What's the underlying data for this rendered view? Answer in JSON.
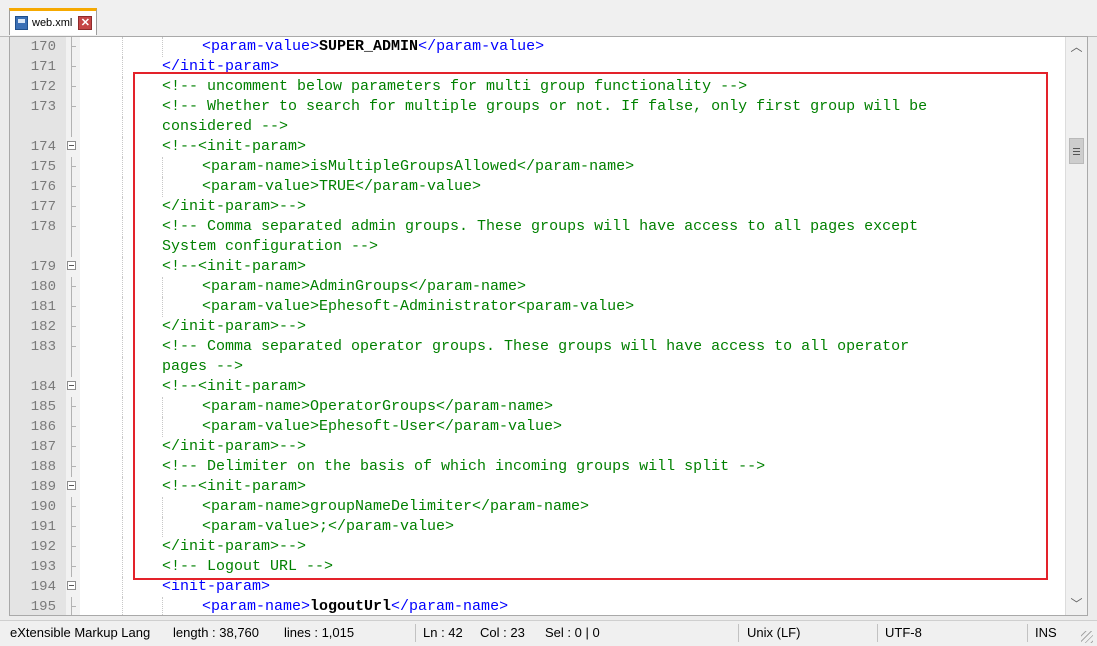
{
  "tab": {
    "filename": "web.xml",
    "close_glyph": "✕"
  },
  "editor": {
    "lines": [
      {
        "n": "170",
        "indent": 2,
        "parts": [
          {
            "c": "tag",
            "t": "<param-value>"
          },
          {
            "c": "txt",
            "t": "SUPER_ADMIN"
          },
          {
            "c": "tag",
            "t": "</param-value>"
          }
        ]
      },
      {
        "n": "171",
        "indent": 1,
        "parts": [
          {
            "c": "tag",
            "t": "</init-param>"
          }
        ]
      },
      {
        "n": "172",
        "indent": 1,
        "parts": [
          {
            "c": "cmt",
            "t": "<!-- uncomment below parameters for multi group functionality -->"
          }
        ]
      },
      {
        "n": "173",
        "indent": 1,
        "parts": [
          {
            "c": "cmt",
            "t": "<!-- Whether to search for multiple groups or not. If false, only first group will be"
          }
        ]
      },
      {
        "n": "",
        "indent": 1,
        "parts": [
          {
            "c": "cmt",
            "t": "considered -->"
          }
        ]
      },
      {
        "n": "174",
        "indent": 1,
        "fold": true,
        "parts": [
          {
            "c": "cmt",
            "t": "<!--<init-param>"
          }
        ]
      },
      {
        "n": "175",
        "indent": 2,
        "parts": [
          {
            "c": "cmt",
            "t": "<param-name>isMultipleGroupsAllowed</param-name>"
          }
        ]
      },
      {
        "n": "176",
        "indent": 2,
        "parts": [
          {
            "c": "cmt",
            "t": "<param-value>TRUE</param-value>"
          }
        ]
      },
      {
        "n": "177",
        "indent": 1,
        "parts": [
          {
            "c": "cmt",
            "t": "</init-param>-->"
          }
        ]
      },
      {
        "n": "178",
        "indent": 1,
        "parts": [
          {
            "c": "cmt",
            "t": "<!-- Comma separated admin groups. These groups will have access to all pages except"
          }
        ]
      },
      {
        "n": "",
        "indent": 1,
        "parts": [
          {
            "c": "cmt",
            "t": "System configuration -->"
          }
        ]
      },
      {
        "n": "179",
        "indent": 1,
        "fold": true,
        "parts": [
          {
            "c": "cmt",
            "t": "<!--<init-param>"
          }
        ]
      },
      {
        "n": "180",
        "indent": 2,
        "parts": [
          {
            "c": "cmt",
            "t": "<param-name>AdminGroups</param-name>"
          }
        ]
      },
      {
        "n": "181",
        "indent": 2,
        "parts": [
          {
            "c": "cmt",
            "t": "<param-value>Ephesoft-Administrator<param-value>"
          }
        ]
      },
      {
        "n": "182",
        "indent": 1,
        "parts": [
          {
            "c": "cmt",
            "t": "</init-param>-->"
          }
        ]
      },
      {
        "n": "183",
        "indent": 1,
        "parts": [
          {
            "c": "cmt",
            "t": "<!-- Comma separated operator groups. These groups will have access to all operator"
          }
        ]
      },
      {
        "n": "",
        "indent": 1,
        "parts": [
          {
            "c": "cmt",
            "t": "pages -->"
          }
        ]
      },
      {
        "n": "184",
        "indent": 1,
        "fold": true,
        "parts": [
          {
            "c": "cmt",
            "t": "<!--<init-param>"
          }
        ]
      },
      {
        "n": "185",
        "indent": 2,
        "parts": [
          {
            "c": "cmt",
            "t": "<param-name>OperatorGroups</param-name>"
          }
        ]
      },
      {
        "n": "186",
        "indent": 2,
        "parts": [
          {
            "c": "cmt",
            "t": "<param-value>Ephesoft-User</param-value>"
          }
        ]
      },
      {
        "n": "187",
        "indent": 1,
        "parts": [
          {
            "c": "cmt",
            "t": "</init-param>-->"
          }
        ]
      },
      {
        "n": "188",
        "indent": 1,
        "parts": [
          {
            "c": "cmt",
            "t": "<!-- Delimiter on the basis of which incoming groups will split -->"
          }
        ]
      },
      {
        "n": "189",
        "indent": 1,
        "fold": true,
        "parts": [
          {
            "c": "cmt",
            "t": "<!--<init-param>"
          }
        ]
      },
      {
        "n": "190",
        "indent": 2,
        "parts": [
          {
            "c": "cmt",
            "t": "<param-name>groupNameDelimiter</param-name>"
          }
        ]
      },
      {
        "n": "191",
        "indent": 2,
        "parts": [
          {
            "c": "cmt",
            "t": "<param-value>;</param-value>"
          }
        ]
      },
      {
        "n": "192",
        "indent": 1,
        "parts": [
          {
            "c": "cmt",
            "t": "</init-param>-->"
          }
        ]
      },
      {
        "n": "193",
        "indent": 1,
        "parts": [
          {
            "c": "cmt",
            "t": "<!-- Logout URL -->"
          }
        ]
      },
      {
        "n": "194",
        "indent": 1,
        "fold": true,
        "parts": [
          {
            "c": "tag",
            "t": "<init-param>"
          }
        ]
      },
      {
        "n": "195",
        "indent": 2,
        "parts": [
          {
            "c": "tag",
            "t": "<param-name>"
          },
          {
            "c": "txt",
            "t": "logoutUrl"
          },
          {
            "c": "tag",
            "t": "</param-name>"
          }
        ]
      }
    ]
  },
  "status": {
    "language": "eXtensible Markup Lang",
    "length": "length : 38,760",
    "lines": "lines : 1,015",
    "ln": "Ln : 42",
    "col": "Col : 23",
    "sel": "Sel : 0 | 0",
    "eol": "Unix (LF)",
    "encoding": "UTF-8",
    "mode": "INS"
  },
  "colors": {
    "highlight": "#e3222a",
    "tag": "#0000ff",
    "comment": "#008000",
    "text": "#000000"
  }
}
